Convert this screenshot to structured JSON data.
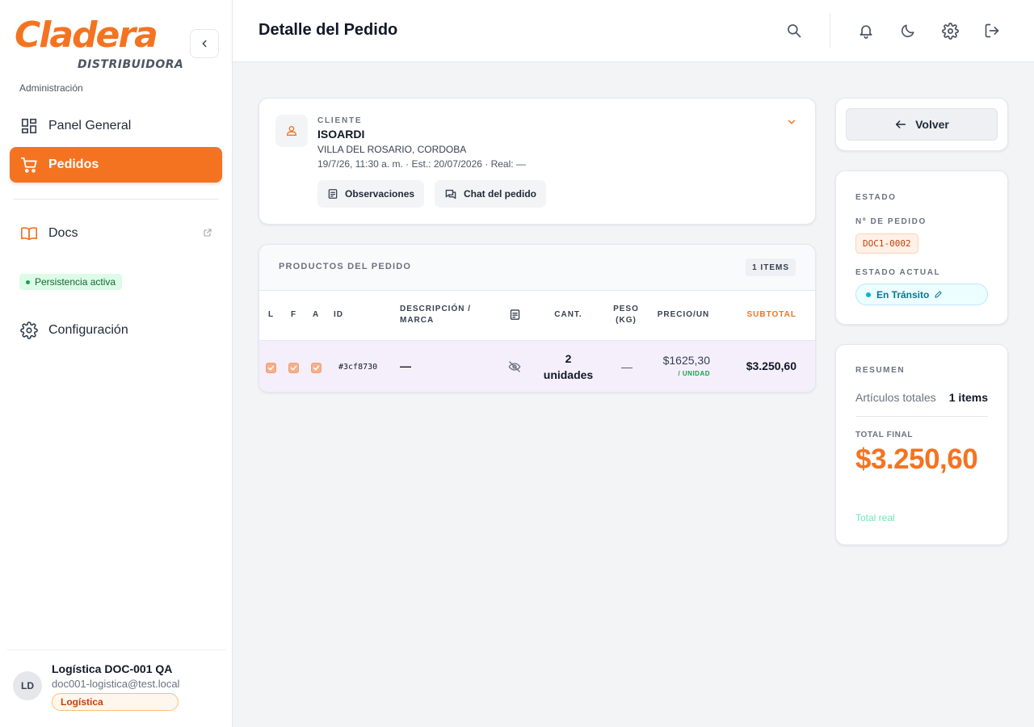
{
  "brand": {
    "logo_word": "Cladera",
    "logo_sub": "DISTRIBUIDORA",
    "area_label": "Administración",
    "accent_color": "#f47321"
  },
  "sidebar": {
    "items": [
      {
        "label": "Panel General",
        "icon": "dashboard-icon",
        "active": false
      },
      {
        "label": "Pedidos",
        "icon": "shopping-cart-icon",
        "active": true
      },
      {
        "label": "Docs",
        "icon": "book-icon",
        "active": false,
        "external": true
      },
      {
        "label": "Configuración",
        "icon": "gear-icon",
        "active": false
      }
    ],
    "persistence_badge": "Persistencia activa"
  },
  "user": {
    "initials": "LD",
    "name": "Logística DOC-001 QA",
    "email": "doc001-logistica@test.local",
    "role": "Logística"
  },
  "header": {
    "title": "Detalle del Pedido",
    "icons": [
      "search-icon",
      "bell-icon",
      "moon-icon",
      "gear-icon",
      "logout-icon"
    ]
  },
  "client": {
    "label": "CLIENTE",
    "name": "ISOARDI",
    "location": "VILLA DEL ROSARIO, CORDOBA",
    "dates": "19/7/26, 11:30 a. m. · Est.: 20/07/2026 · Real: —",
    "buttons": {
      "observations": "Observaciones",
      "chat": "Chat del pedido"
    }
  },
  "products": {
    "title": "PRODUCTOS DEL PEDIDO",
    "count_badge": "1 ITEMS",
    "columns": {
      "l": "L",
      "f": "F",
      "a": "A",
      "id": "ID",
      "desc_line1": "DESCRIPCIÓN /",
      "desc_line2": "MARCA",
      "qty": "CANT.",
      "weight_line1": "PESO",
      "weight_line2": "(KG)",
      "price": "PRECIO/UN",
      "subtotal": "SUBTOTAL"
    },
    "rows": [
      {
        "l": true,
        "f": true,
        "a": true,
        "id": "#3cf8730",
        "description": "—",
        "qty_number": "2",
        "qty_unit": "unidades",
        "weight": "—",
        "price": "$1625,30",
        "price_unit": "/ UNIDAD",
        "subtotal": "$3.250,60"
      }
    ]
  },
  "actions": {
    "back_label": "Volver"
  },
  "status": {
    "section_label": "ESTADO",
    "order_number_label": "Nº DE PEDIDO",
    "order_number": "DOC1-0002",
    "current_status_label": "ESTADO ACTUAL",
    "current_status": "En Tránsito"
  },
  "summary": {
    "section_label": "RESUMEN",
    "items_label": "Artículos totales",
    "items_value": "1 items",
    "total_label": "TOTAL FINAL",
    "total_value": "$3.250,60",
    "total_note": "Total real"
  }
}
